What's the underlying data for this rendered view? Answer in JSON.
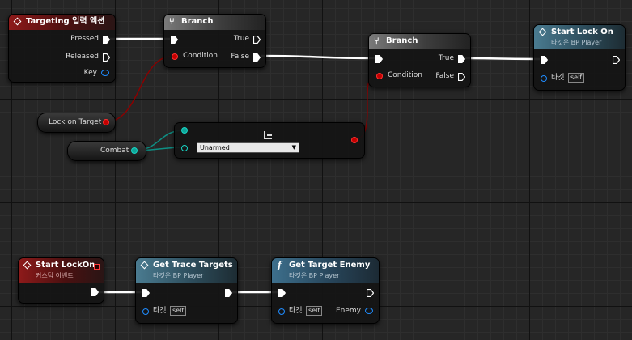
{
  "nodes": {
    "targeting": {
      "title": "Targeting 입력 액션",
      "pins": {
        "pressed": "Pressed",
        "released": "Released",
        "key": "Key"
      }
    },
    "branch1": {
      "title": "Branch",
      "pins": {
        "condition": "Condition",
        "true": "True",
        "false": "False"
      }
    },
    "branch2": {
      "title": "Branch",
      "pins": {
        "condition": "Condition",
        "true": "True",
        "false": "False"
      }
    },
    "start_lock_on": {
      "title": "Start Lock On",
      "subtitle": "타깃은 BP Player",
      "pins": {
        "target": "타깃",
        "self": "self"
      }
    },
    "lock_on_target": {
      "label": "Lock on Target"
    },
    "combat": {
      "label": "Combat"
    },
    "select": {
      "icon": "select-icon",
      "option": "Unarmed"
    },
    "custom_event": {
      "title": "Start LockOn",
      "subtitle": "커스텀 이벤트"
    },
    "get_trace_targets": {
      "title": "Get Trace Targets",
      "subtitle": "타깃은 BP Player",
      "pins": {
        "target": "타깃",
        "self": "self"
      }
    },
    "get_target_enemy": {
      "title": "Get Target Enemy",
      "subtitle": "타깃은 BP Player",
      "pins": {
        "target": "타깃",
        "self": "self",
        "enemy": "Enemy"
      }
    }
  },
  "colors": {
    "exec": "#ffffff",
    "bool": "#c40000",
    "enum": "#0fa598",
    "object": "#1f8cff",
    "event_header": "#8e1a1a",
    "function_header": "#3d6f8c"
  }
}
